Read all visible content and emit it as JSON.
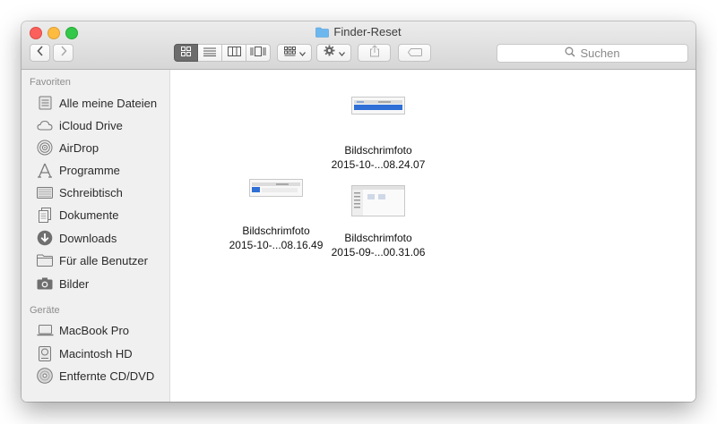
{
  "window": {
    "title": "Finder-Reset"
  },
  "search": {
    "placeholder": "Suchen"
  },
  "sidebar": {
    "favorites_header": "Favoriten",
    "favorites": [
      {
        "label": "Alle meine Dateien",
        "icon": "all-files-icon"
      },
      {
        "label": "iCloud Drive",
        "icon": "cloud-icon"
      },
      {
        "label": "AirDrop",
        "icon": "airdrop-icon"
      },
      {
        "label": "Programme",
        "icon": "applications-icon"
      },
      {
        "label": "Schreibtisch",
        "icon": "desktop-icon"
      },
      {
        "label": "Dokumente",
        "icon": "documents-icon"
      },
      {
        "label": "Downloads",
        "icon": "downloads-icon"
      },
      {
        "label": "Für alle Benutzer",
        "icon": "folder-icon"
      },
      {
        "label": "Bilder",
        "icon": "camera-icon"
      }
    ],
    "devices_header": "Geräte",
    "devices": [
      {
        "label": "MacBook Pro",
        "icon": "laptop-icon"
      },
      {
        "label": "Macintosh HD",
        "icon": "hard-disk-icon"
      },
      {
        "label": "Entfernte CD/DVD",
        "icon": "disc-icon"
      }
    ]
  },
  "files": [
    {
      "line1": "Bildschrimfoto",
      "line2": "2015-10-...08.24.07"
    },
    {
      "line1": "Bildschrimfoto",
      "line2": "2015-09-...00.31.06"
    },
    {
      "line1": "Bildschrimfoto",
      "line2": "2015-10-...08.16.49"
    }
  ]
}
